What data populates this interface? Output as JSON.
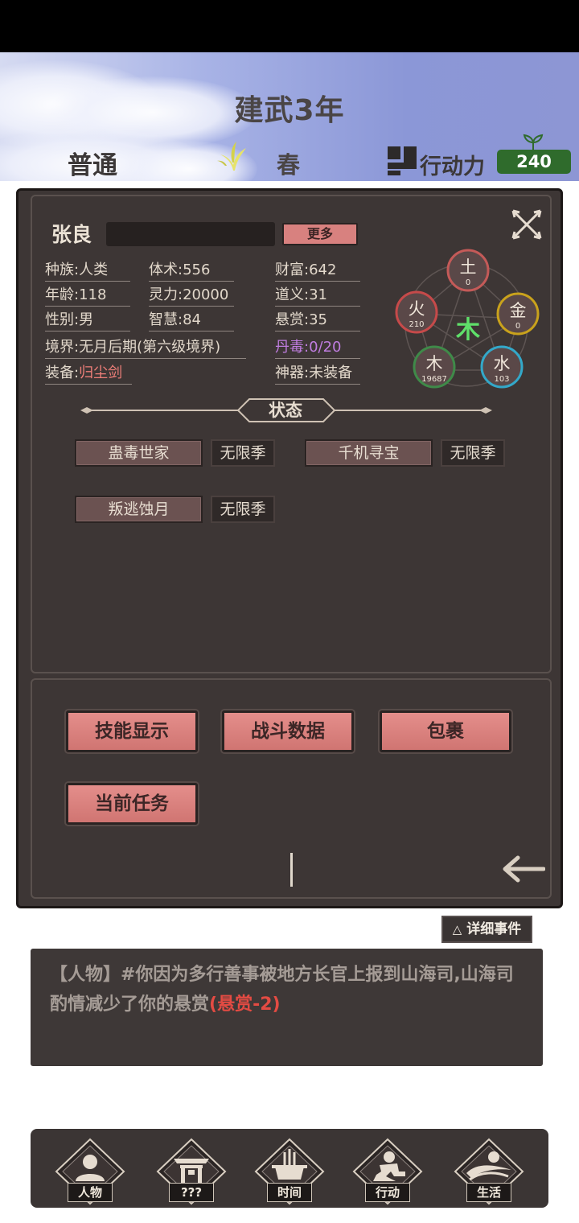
{
  "header": {
    "year": "建武3年",
    "difficulty": "普通",
    "season": "春",
    "action_points_label": "行动力",
    "action_points_value": "240"
  },
  "character": {
    "name": "张良",
    "more_label": "更多",
    "stats": {
      "race": "种族:人类",
      "age": "年龄:118",
      "gender": "性别:男",
      "realm": "境界:无月后期(第六级境界)",
      "equipment_label": "装备:",
      "equipment_value": "归尘剑",
      "body": "体术:556",
      "spirit": "灵力:20000",
      "wisdom": "智慧:84",
      "wealth": "财富:642",
      "righteousness": "道义:31",
      "bounty": "悬赏:35",
      "poison": "丹毒:0/20",
      "artifact": "神器:未装备"
    },
    "five_elements": {
      "center": "木",
      "earth": {
        "label": "土",
        "value": "0",
        "color": "#c45a58"
      },
      "metal": {
        "label": "金",
        "value": "0",
        "color": "#c9a21c"
      },
      "water": {
        "label": "水",
        "value": "103",
        "color": "#33a8c9"
      },
      "wood": {
        "label": "木",
        "value": "19687",
        "color": "#3f8a49"
      },
      "fire": {
        "label": "火",
        "value": "210",
        "color": "#c64a4a"
      }
    }
  },
  "status": {
    "title": "状态",
    "items": [
      {
        "name": "蛊毒世家",
        "duration": "无限季"
      },
      {
        "name": "千机寻宝",
        "duration": "无限季"
      },
      {
        "name": "叛逃蚀月",
        "duration": "无限季"
      }
    ]
  },
  "actions": {
    "skills": "技能显示",
    "battle": "战斗数据",
    "bag": "包裹",
    "quest": "当前任务"
  },
  "log": {
    "detail_button": "详细事件",
    "detail_icon": "△",
    "text_prefix": "【人物】#你因为多行善事被地方长官上报到山海司,山海司酌情减少了你的悬赏",
    "text_highlight": "(悬赏-2)"
  },
  "nav": {
    "character": "人物",
    "unknown": "???",
    "time": "时间",
    "action": "行动",
    "life": "生活"
  }
}
